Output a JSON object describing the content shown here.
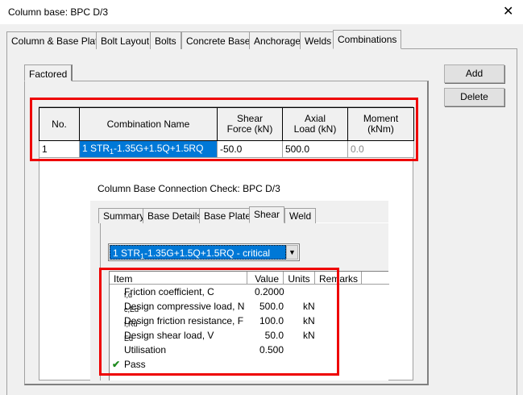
{
  "window": {
    "title": "Column base: BPC D/3",
    "close": "✕"
  },
  "tabs": [
    "Column & Base Plate",
    "Bolt Layout",
    "Bolts",
    "Concrete Base",
    "Anchorage",
    "Welds",
    "Combinations"
  ],
  "subtab": "Factored",
  "buttons": {
    "add": "Add",
    "delete": "Delete"
  },
  "grid": {
    "headers": {
      "no": "No.",
      "name": "Combination Name",
      "shear_1": "Shear",
      "shear_2": "Force (kN)",
      "axial_1": "Axial",
      "axial_2": "Load (kN)",
      "moment_1": "Moment",
      "moment_2": "(kNm)"
    },
    "rows": [
      {
        "no": "1",
        "name_pre": "1 STR",
        "name_sub": "1",
        "name_post": "-1.35G+1.5Q+1.5RQ",
        "shear": "-50.0",
        "axial": "500.0",
        "moment": "0.0"
      }
    ]
  },
  "check": {
    "title": "Column Base Connection Check: BPC D/3",
    "tabs": [
      "Summary",
      "Base Details",
      "Base Plate",
      "Shear",
      "Weld"
    ],
    "combo": {
      "pre": "1 STR",
      "sub": "1",
      "post": "-1.35G+1.5Q+1.5RQ - critical"
    },
    "columns": [
      "Item",
      "Value",
      "Units",
      "Remarks"
    ],
    "rows": [
      {
        "item": "Friction coefficient, C",
        "sub": "f,d",
        "value": "0.2000",
        "units": ""
      },
      {
        "item": "Design compressive load, N",
        "sub": "c,Ed",
        "value": "500.0",
        "units": "kN"
      },
      {
        "item": "Design friction resistance, F",
        "sub": "f,Rd",
        "value": "100.0",
        "units": "kN"
      },
      {
        "item": "Design shear load, V",
        "sub": "Ed",
        "value": "50.0",
        "units": "kN"
      },
      {
        "item": "Utilisation",
        "sub": "",
        "value": "0.500",
        "units": ""
      }
    ],
    "result": "Pass",
    "pass_color": "#1e8a1e"
  },
  "highlight_color": "#e00000"
}
